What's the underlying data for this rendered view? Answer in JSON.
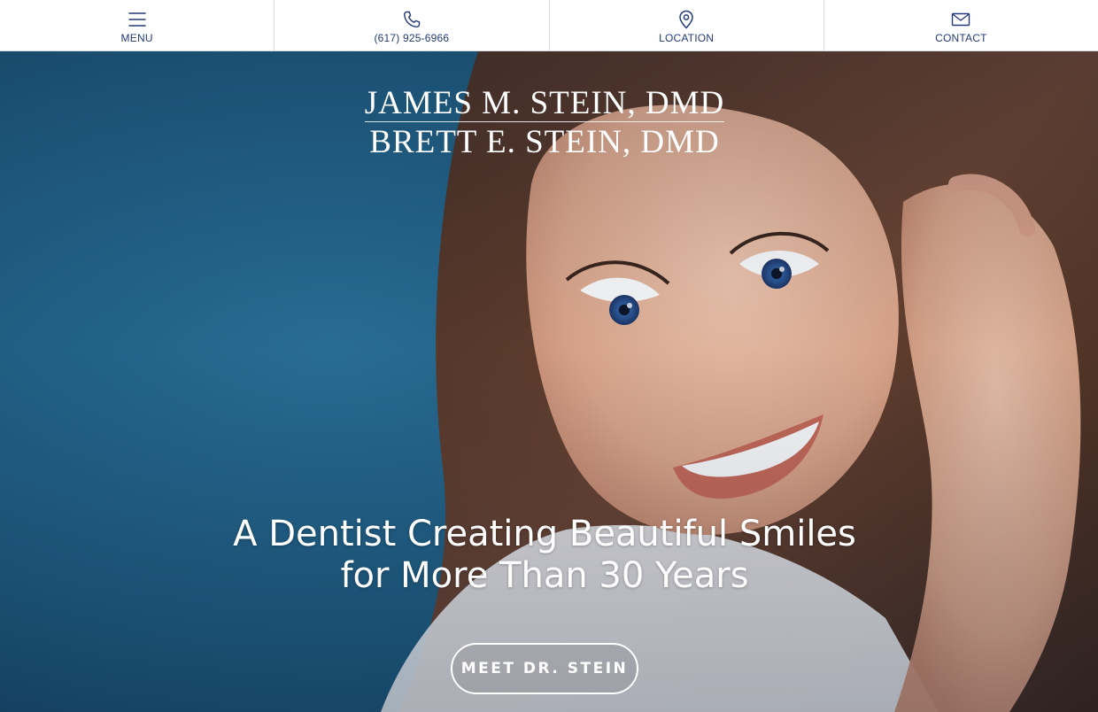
{
  "nav": {
    "items": [
      {
        "label": "MENU",
        "icon": "menu-icon"
      },
      {
        "label": "(617) 925-6966",
        "icon": "phone-icon"
      },
      {
        "label": "LOCATION",
        "icon": "location-pin-icon"
      },
      {
        "label": "CONTACT",
        "icon": "envelope-icon"
      }
    ]
  },
  "hero": {
    "logo_line_1": "JAMES M. STEIN, DMD",
    "logo_line_2": "BRETT E. STEIN, DMD",
    "tagline_line_1": "A Dentist Creating Beautiful Smiles",
    "tagline_line_2": "for More Than 30 Years",
    "cta_label": "MEET DR. STEIN",
    "image": "smiling-woman-portrait"
  },
  "colors": {
    "nav_text": "#233a7a",
    "hero_background": "#1d5a7c",
    "hero_text": "#ffffff"
  }
}
